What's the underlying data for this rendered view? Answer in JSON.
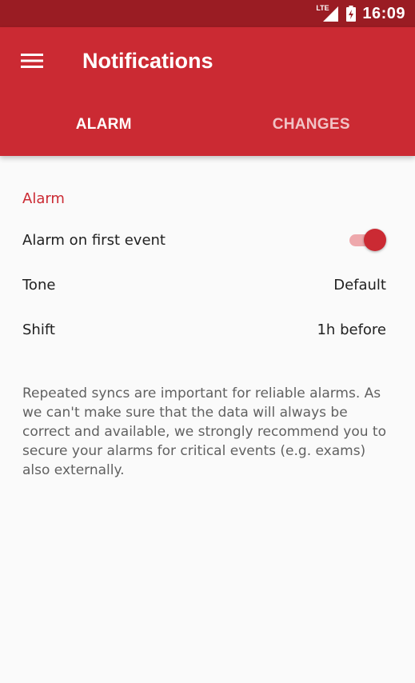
{
  "status_bar": {
    "network_label": "LTE",
    "time": "16:09"
  },
  "app_bar": {
    "title": "Notifications",
    "tabs": [
      {
        "label": "ALARM",
        "active": true
      },
      {
        "label": "CHANGES",
        "active": false
      }
    ]
  },
  "alarm_section": {
    "header": "Alarm",
    "alarm_on_first_event": {
      "label": "Alarm on first event",
      "enabled": true
    },
    "tone": {
      "label": "Tone",
      "value": "Default"
    },
    "shift": {
      "label": "Shift",
      "value": "1h before"
    }
  },
  "info_text": "Repeated syncs are important for reliable alarms. As we can't make sure that the data will always be correct and available, we strongly recommend you to secure your alarms for critical events (e.g. exams) also externally.",
  "colors": {
    "primary": "#cb2a33",
    "primary_dark": "#9a1c23",
    "toggle_track": "#eea8ac"
  }
}
